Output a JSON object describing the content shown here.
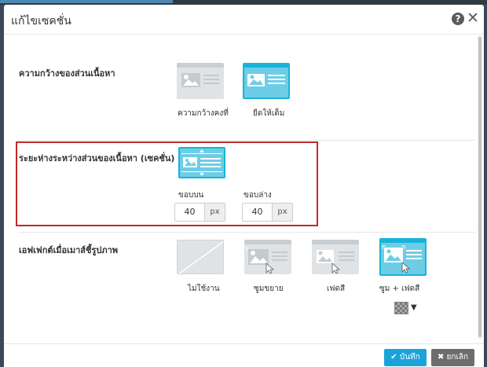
{
  "dialog": {
    "title": "แก้ไขเซคชั่น",
    "help_glyph": "?",
    "close_glyph": "✕"
  },
  "content_width": {
    "label": "ความกว้างของส่วนเนื้อหา",
    "options": [
      {
        "label": "ความกว้างคงที่",
        "selected": false
      },
      {
        "label": "ยืดให้เต็ม",
        "selected": true
      }
    ]
  },
  "content_spacing": {
    "label": "ระยะห่างระหว่างส่วนของเนื้อหา (เซคชั่น)",
    "top": {
      "label": "ขอบบน",
      "value": "40",
      "unit": "px"
    },
    "bottom": {
      "label": "ขอบล่าง",
      "value": "40",
      "unit": "px"
    }
  },
  "hover_effect": {
    "label": "เอฟเฟกต์เมื่อเมาส์ชี้รูปภาพ",
    "options": [
      {
        "label": "ไม่ใช้งาน",
        "selected": false
      },
      {
        "label": "ซูมขยาย",
        "selected": false
      },
      {
        "label": "เฟดสี",
        "selected": false
      },
      {
        "label": "ซูม + เฟดสี",
        "selected": true
      }
    ],
    "pattern_caret": "▼"
  },
  "footer": {
    "save_label": "บันทึก",
    "save_glyph": "✔",
    "cancel_label": "ยกเลิก",
    "cancel_glyph": "✖"
  },
  "colors": {
    "accent": "#18b3da",
    "highlight_border": "#c2282a",
    "save_button": "#1aa3d9",
    "cancel_button": "#6d6d6d"
  }
}
